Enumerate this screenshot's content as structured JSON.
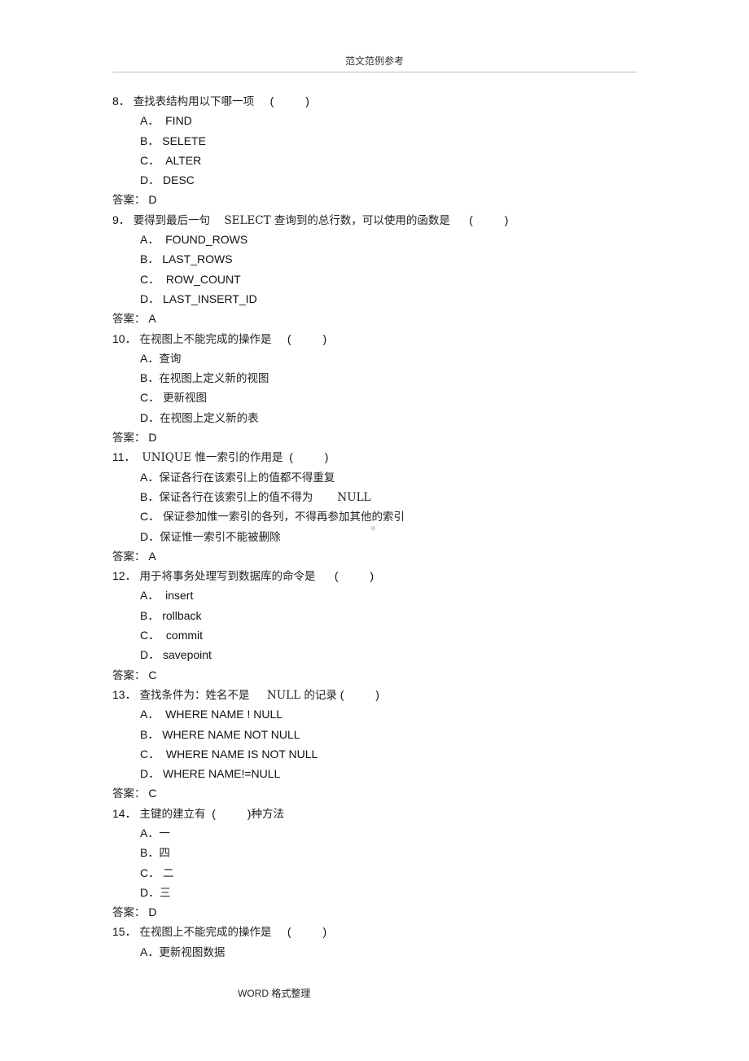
{
  "header": {
    "title": "范文范例参考"
  },
  "footer": {
    "text": "WORD 格式整理"
  },
  "answer_label": "答案：",
  "questions": [
    {
      "number": "8．",
      "text": "查找表结构用以下哪一项",
      "blank": "(          )",
      "options": [
        {
          "label": "A．",
          "text": "FIND"
        },
        {
          "label": "B．",
          "text": "SELETE"
        },
        {
          "label": "C．",
          "text": "ALTER"
        },
        {
          "label": "D．",
          "text": "DESC"
        }
      ],
      "answer": "D"
    },
    {
      "number": "9．",
      "text": "要得到最后一句    SELECT 查询到的总行数，可以使用的函数是",
      "blank": "(          )",
      "options": [
        {
          "label": "A．",
          "text": "FOUND_ROWS"
        },
        {
          "label": "B．",
          "text": "LAST_ROWS"
        },
        {
          "label": "C．",
          "text": "ROW_COUNT"
        },
        {
          "label": "D．",
          "text": "LAST_INSERT_ID"
        }
      ],
      "answer": "A"
    },
    {
      "number": "10．",
      "text": "在视图上不能完成的操作是",
      "blank": "(          )",
      "options": [
        {
          "label": "A．",
          "text": "查询"
        },
        {
          "label": "B．",
          "text": "在视图上定义新的视图"
        },
        {
          "label": "C．",
          "text": "更新视图"
        },
        {
          "label": "D．",
          "text": "在视图上定义新的表"
        }
      ],
      "answer": "D"
    },
    {
      "number": "11．",
      "text": "UNIQUE 惟一索引的作用是",
      "blank": "(          )",
      "options": [
        {
          "label": "A．",
          "text": "保证各行在该索引上的值都不得重复"
        },
        {
          "label": "B．",
          "text": "保证各行在该索引上的值不得为       NULL"
        },
        {
          "label": "C．",
          "text": "保证参加惟一索引的各列，不得再参加其他的索引"
        },
        {
          "label": "D．",
          "text": "保证惟一索引不能被删除"
        }
      ],
      "answer": "A"
    },
    {
      "number": "12．",
      "text": "用于将事务处理写到数据库的命令是",
      "blank": "(          )",
      "options": [
        {
          "label": "A．",
          "text": "insert"
        },
        {
          "label": "B．",
          "text": "rollback"
        },
        {
          "label": "C．",
          "text": "commit"
        },
        {
          "label": "D．",
          "text": "savepoint"
        }
      ],
      "answer": "C"
    },
    {
      "number": "13．",
      "text": "查找条件为：姓名不是     NULL 的记录",
      "blank": "(          )",
      "options": [
        {
          "label": "A．",
          "text": "WHERE NAME ! NULL"
        },
        {
          "label": "B．",
          "text": "WHERE NAME NOT NULL"
        },
        {
          "label": "C．",
          "text": "WHERE NAME IS NOT NULL"
        },
        {
          "label": "D．",
          "text": "WHERE NAME!=NULL"
        }
      ],
      "answer": "C"
    },
    {
      "number": "14．",
      "text": "主键的建立有",
      "blank": "(          )",
      "suffix": "种方法",
      "options": [
        {
          "label": "A．",
          "text": "一"
        },
        {
          "label": "B．",
          "text": "四"
        },
        {
          "label": "C．",
          "text": "二"
        },
        {
          "label": "D．",
          "text": "三"
        }
      ],
      "answer": "D"
    },
    {
      "number": "15．",
      "text": "在视图上不能完成的操作是",
      "blank": "(          )",
      "options": [
        {
          "label": "A．",
          "text": "更新视图数据"
        }
      ]
    }
  ]
}
